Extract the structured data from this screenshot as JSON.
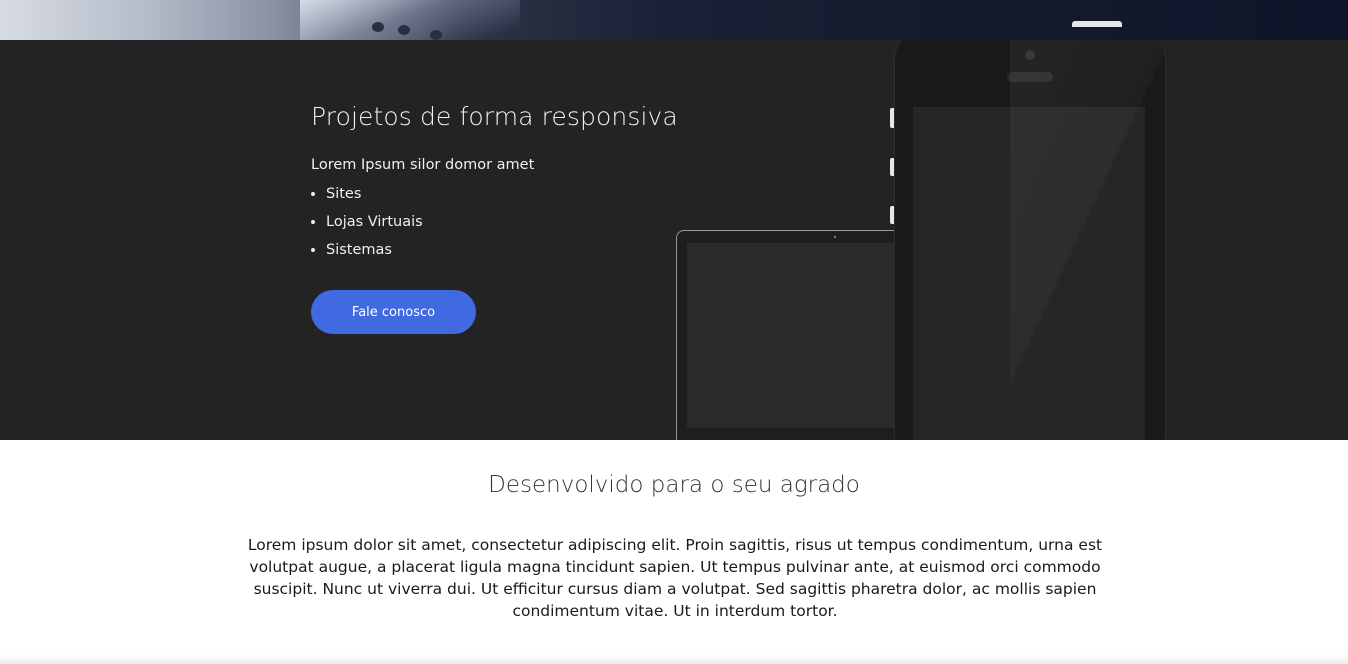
{
  "hero": {
    "title": "Projetos de forma responsiva",
    "intro": "Lorem Ipsum silor domor amet",
    "items": [
      "Sites",
      "Lojas Virtuais",
      "Sistemas"
    ],
    "cta_label": "Fale conosco",
    "background_color": "#232323",
    "accent_color": "#4169e1"
  },
  "section": {
    "title": "Desenvolvido para o seu agrado",
    "body": "Lorem ipsum dolor sit amet, consectetur adipiscing elit. Proin sagittis, risus ut tempus condimentum, urna est volutpat augue, a placerat ligula magna tincidunt sapien. Ut tempus pulvinar ante, at euismod orci commodo suscipit. Nunc ut viverra dui. Ut efficitur cursus diam a volutpat. Sed sagittis pharetra dolor, ac mollis sapien condimentum vitae. Ut in interdum tortor."
  }
}
